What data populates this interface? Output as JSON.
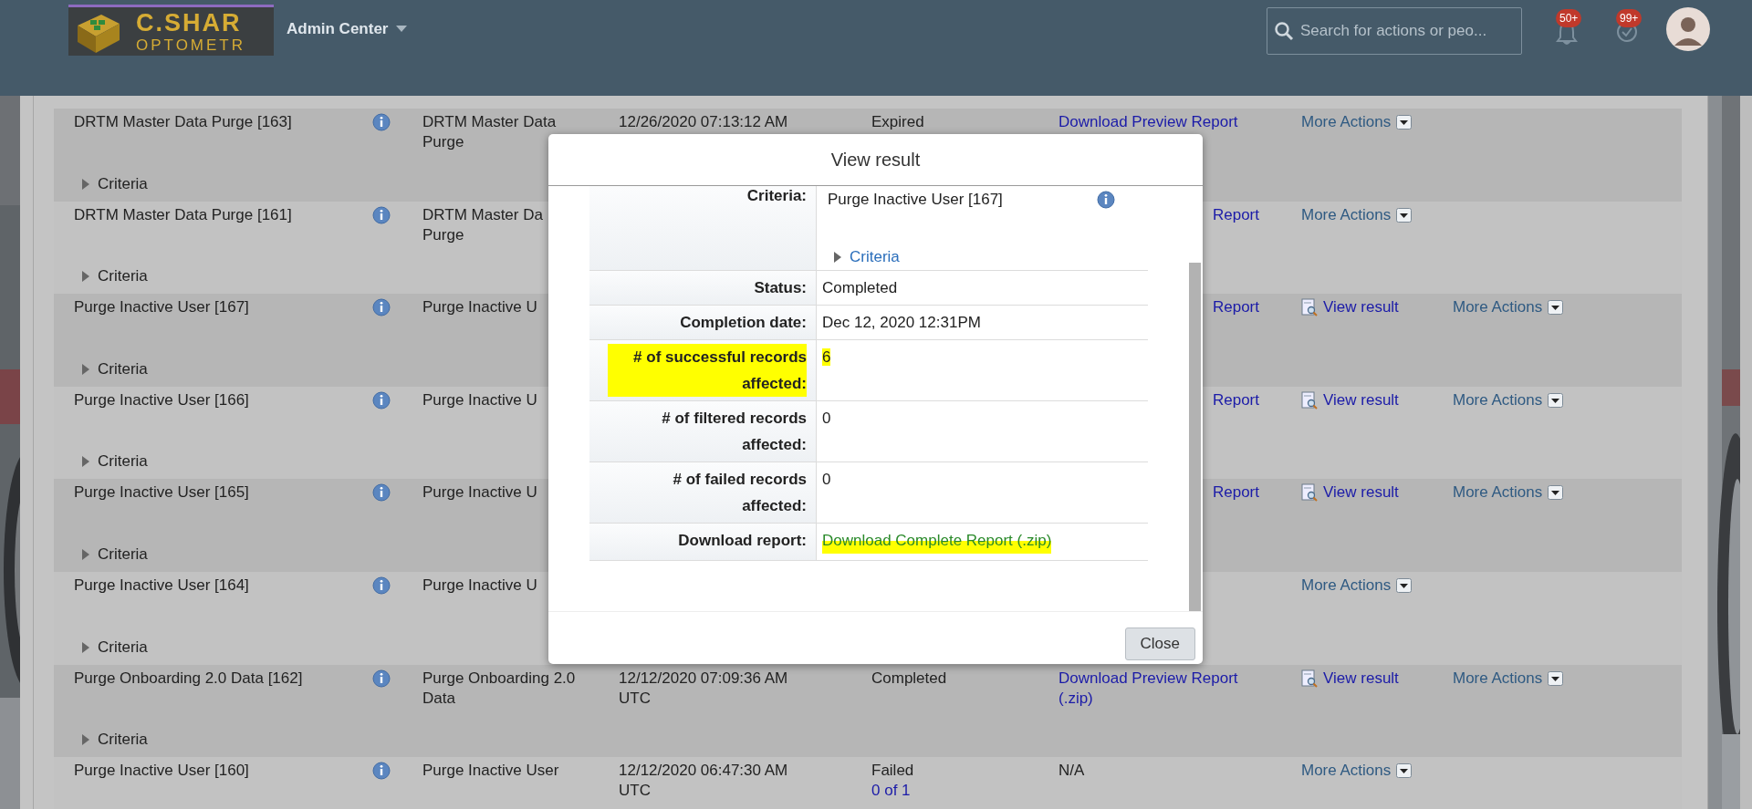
{
  "header": {
    "logo": {
      "line_1": "C.SHAR",
      "line_2": "OPTOMETR"
    },
    "title": "Admin Center",
    "search": {
      "placeholder": "Search for actions or peo..."
    },
    "notifications": [
      {
        "kind": "bell",
        "badge": "50+"
      },
      {
        "kind": "todo",
        "badge": "99+"
      }
    ]
  },
  "rows": [
    {
      "name": "DRTM Master Data Purge [163]",
      "type_lines": [
        "DRTM Master Data",
        "Purge"
      ],
      "date_lines": [
        "12/26/2020 07:13:12 AM"
      ],
      "status": "Expired",
      "download": {
        "lines": [
          "Download Preview Report"
        ],
        "link": true,
        "cut": false
      },
      "actions": [
        {
          "kind": "more",
          "label": "More Actions"
        }
      ],
      "criteria": "Criteria"
    },
    {
      "name": "DRTM Master Data Purge [161]",
      "type_lines": [
        "DRTM Master Da",
        "Purge"
      ],
      "download": {
        "lines": [
          "Report"
        ],
        "link": true,
        "cut": true
      },
      "actions": [
        {
          "kind": "more",
          "label": "More Actions"
        }
      ],
      "criteria": "Criteria"
    },
    {
      "name": "Purge Inactive User [167]",
      "type_lines": [
        "Purge Inactive U"
      ],
      "download": {
        "lines": [
          "Report"
        ],
        "link": true,
        "cut": true
      },
      "actions": [
        {
          "kind": "view",
          "label": "View result"
        },
        {
          "kind": "more",
          "label": "More Actions"
        }
      ],
      "criteria": "Criteria"
    },
    {
      "name": "Purge Inactive User [166]",
      "type_lines": [
        "Purge Inactive U"
      ],
      "download": {
        "lines": [
          "Report"
        ],
        "link": true,
        "cut": true
      },
      "actions": [
        {
          "kind": "view",
          "label": "View result"
        },
        {
          "kind": "more",
          "label": "More Actions"
        }
      ],
      "criteria": "Criteria"
    },
    {
      "name": "Purge Inactive User [165]",
      "type_lines": [
        "Purge Inactive U"
      ],
      "download": {
        "lines": [
          "Report"
        ],
        "link": true,
        "cut": true
      },
      "actions": [
        {
          "kind": "view",
          "label": "View result"
        },
        {
          "kind": "more",
          "label": "More Actions"
        }
      ],
      "criteria": "Criteria"
    },
    {
      "name": "Purge Inactive User [164]",
      "type_lines": [
        "Purge Inactive U"
      ],
      "actions": [
        {
          "kind": "more",
          "label": "More Actions"
        }
      ],
      "criteria": "Criteria"
    },
    {
      "name": "Purge Onboarding 2.0 Data [162]",
      "type_lines": [
        "Purge Onboarding 2.0",
        "Data"
      ],
      "date_lines": [
        "12/12/2020 07:09:36 AM",
        "UTC"
      ],
      "status": "Completed",
      "download": {
        "lines": [
          "Download Preview Report",
          "(.zip)"
        ],
        "link": true,
        "cut": false
      },
      "actions": [
        {
          "kind": "view",
          "label": "View result"
        },
        {
          "kind": "more",
          "label": "More Actions"
        }
      ],
      "criteria": "Criteria"
    },
    {
      "name": "Purge Inactive User [160]",
      "type_lines": [
        "Purge Inactive User"
      ],
      "date_lines": [
        "12/12/2020 06:47:30 AM",
        "UTC"
      ],
      "status": "Failed",
      "status_link": "0 of 1",
      "download": {
        "lines": [
          "N/A"
        ],
        "link": false,
        "cut": false
      },
      "actions": [
        {
          "kind": "more",
          "label": "More Actions"
        }
      ]
    }
  ],
  "dialog": {
    "title": "View result",
    "fields": [
      {
        "label": "Criteria:",
        "kind": "criteria",
        "value": "Purge Inactive User [167]",
        "link": "Criteria",
        "highlighted": false
      },
      {
        "label": "Status:",
        "kind": "text",
        "value": "Completed",
        "highlighted": false
      },
      {
        "label": "Completion date:",
        "kind": "text",
        "value": "Dec 12, 2020 12:31PM",
        "highlighted": false
      },
      {
        "label": "# of successful records affected:",
        "kind": "text",
        "value": "6",
        "highlighted": true
      },
      {
        "label": "# of filtered records affected:",
        "kind": "text",
        "value": "0",
        "highlighted": false
      },
      {
        "label": "# of failed records affected:",
        "kind": "text",
        "value": "0",
        "highlighted": false
      },
      {
        "label": "Download report:",
        "kind": "link",
        "value": "Download Complete Report (.zip)",
        "highlighted": true
      }
    ],
    "close": "Close"
  }
}
